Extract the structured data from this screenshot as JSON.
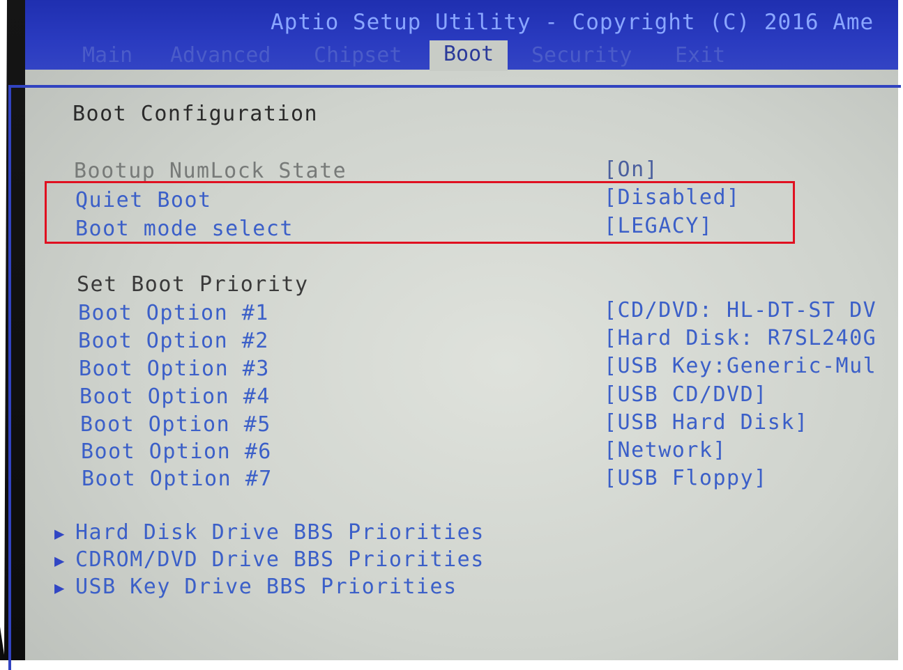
{
  "title": "Aptio Setup Utility - Copyright (C) 2016 Ame",
  "tabs": [
    {
      "label": "Main"
    },
    {
      "label": "Advanced"
    },
    {
      "label": "Chipset"
    },
    {
      "label": "Boot"
    },
    {
      "label": "Security"
    },
    {
      "label": "Exit"
    }
  ],
  "active_tab": "Boot",
  "section_heading": "Boot Configuration",
  "settings": [
    {
      "label": "Bootup NumLock State",
      "value": "[On]"
    },
    {
      "label": "Quiet Boot",
      "value": "[Disabled]"
    },
    {
      "label": "Boot mode select",
      "value": "[LEGACY]"
    }
  ],
  "priority_heading": "Set Boot Priority",
  "boot_options": [
    {
      "label": "Boot Option #1",
      "value": "[CD/DVD: HL-DT-ST DV"
    },
    {
      "label": "Boot Option #2",
      "value": "[Hard Disk: R7SL240G"
    },
    {
      "label": "Boot Option #3",
      "value": "[USB Key:Generic-Mul"
    },
    {
      "label": "Boot Option #4",
      "value": "[USB CD/DVD]"
    },
    {
      "label": "Boot Option #5",
      "value": "[USB Hard Disk]"
    },
    {
      "label": "Boot Option #6",
      "value": "[Network]"
    },
    {
      "label": "Boot Option #7",
      "value": "[USB Floppy]"
    }
  ],
  "submenus": [
    {
      "arrow": "▶",
      "label": "Hard Disk Drive BBS Priorities"
    },
    {
      "arrow": "▶",
      "label": "CDROM/DVD Drive BBS Priorities"
    },
    {
      "arrow": "▶",
      "label": "USB Key Drive BBS Priorities"
    }
  ],
  "annotation": {
    "color": "#e01020"
  },
  "colors": {
    "header_blue": "#2a3bc0",
    "title_text": "#8aa6ff",
    "item_blue": "#3b5fc8",
    "screen_bg": "#d6d9d3"
  }
}
